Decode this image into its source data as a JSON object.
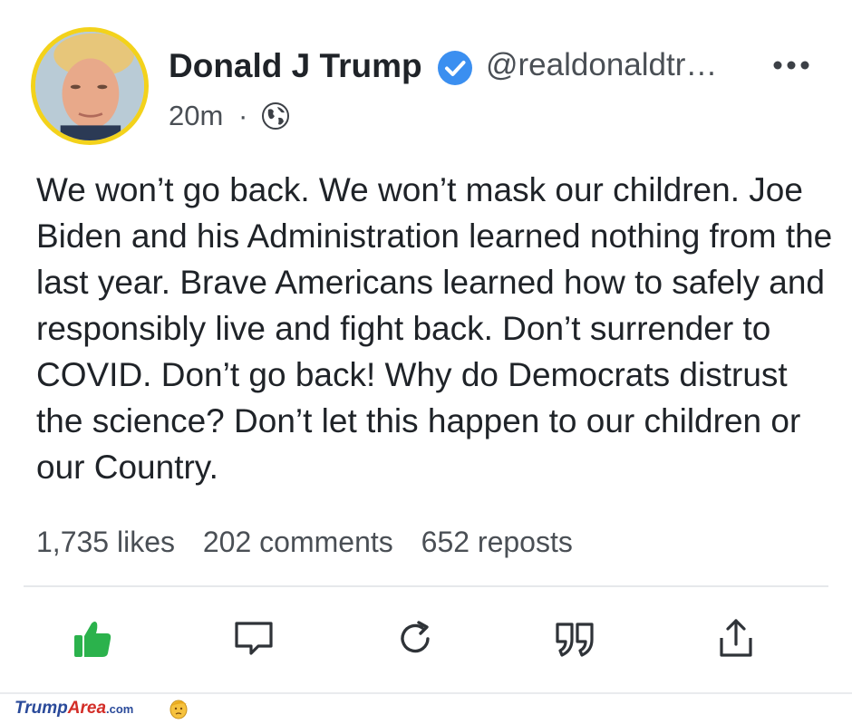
{
  "post": {
    "author_name": "Donald J Trump",
    "handle": "@realdonaldtr…",
    "time": "20m",
    "separator": "·",
    "visibility_icon": "globe-icon",
    "text": "We won’t go back. We won’t mask our children. Joe Biden and his Administration learned nothing from the last year. Brave Americans learned how to safely and responsibly live and fight back. Don’t surrender to COVID. Don’t go back! Why do Democrats distrust the science? Don’t let this happen to our children or our Country."
  },
  "stats": {
    "likes": "1,735 likes",
    "comments": "202 comments",
    "reposts": "652 reposts"
  },
  "actions": [
    {
      "name": "like-button",
      "icon": "thumbs-up-icon",
      "color": "#2bb24c"
    },
    {
      "name": "comment-button",
      "icon": "comment-icon"
    },
    {
      "name": "repost-button",
      "icon": "repost-icon"
    },
    {
      "name": "quote-button",
      "icon": "quote-icon"
    },
    {
      "name": "share-button",
      "icon": "share-icon"
    }
  ],
  "watermark": {
    "part1": "Trump",
    "part2": "Area",
    "part3": ".com"
  },
  "colors": {
    "avatar_ring": "#f3d21b",
    "verified": "#3b8ff0",
    "like_active": "#2bb24c",
    "text": "#1f2328",
    "muted": "#4a4f55"
  }
}
